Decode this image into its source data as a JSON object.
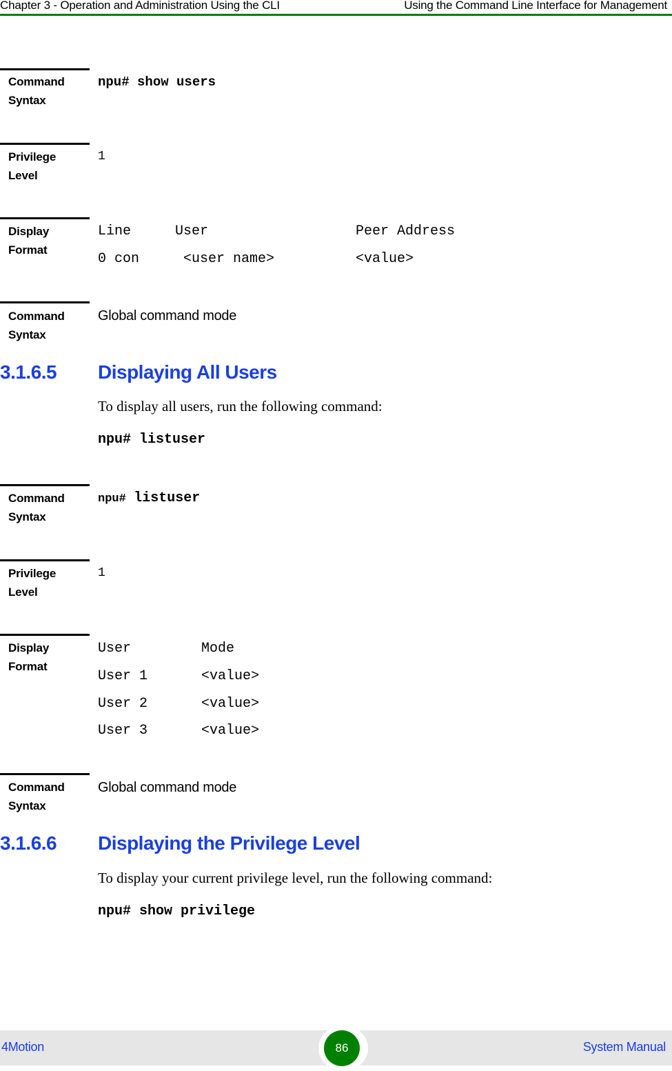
{
  "header": {
    "chapter": "Chapter 3 - Operation and Administration Using the CLI",
    "section": "Using the Command Line Interface for Management"
  },
  "block1": {
    "command_syntax_label": [
      "Command",
      "Syntax"
    ],
    "command_syntax_prefix": "npu#",
    "command_syntax_cmd": "show users",
    "privilege_label": [
      "Privilege",
      "Level"
    ],
    "privilege_value": "1",
    "display_label": [
      "Display",
      "Format"
    ],
    "display_header": [
      "Line",
      "User",
      "Peer Address"
    ],
    "display_row": [
      "0 con",
      "<user name>",
      "<value>"
    ],
    "mode_label": [
      "Command",
      "Syntax"
    ],
    "mode_value": "Global command mode"
  },
  "section_3165": {
    "number": "3.1.6.5",
    "title": "Displaying All Users",
    "intro": "To display all users, run the following command:",
    "command_prefix": "npu#",
    "command": "listuser"
  },
  "block2": {
    "command_syntax_label": [
      "Command",
      "Syntax"
    ],
    "command_syntax_prefix": "npu#",
    "command_syntax_cmd": "listuser",
    "privilege_label": [
      "Privilege",
      "Level"
    ],
    "privilege_value": "1",
    "display_label": [
      "Display",
      "Format"
    ],
    "display_header": [
      "User",
      "Mode"
    ],
    "display_rows": [
      [
        "User 1",
        "<value>"
      ],
      [
        "User 2",
        "<value>"
      ],
      [
        "User 3",
        "<value>"
      ]
    ],
    "mode_label": [
      "Command",
      "Syntax"
    ],
    "mode_value": "Global command mode"
  },
  "section_3166": {
    "number": "3.1.6.6",
    "title": "Displaying the Privilege Level",
    "intro": "To display your current privilege level, run the following command:",
    "command_prefix": "npu#",
    "command": "show privilege"
  },
  "footer": {
    "product": "4Motion",
    "page_number": "86",
    "doc_title": "System Manual"
  },
  "colors": {
    "accent_green": "#008000",
    "heading_blue": "#1a3fe0",
    "footer_bg": "#e6e6e6"
  }
}
